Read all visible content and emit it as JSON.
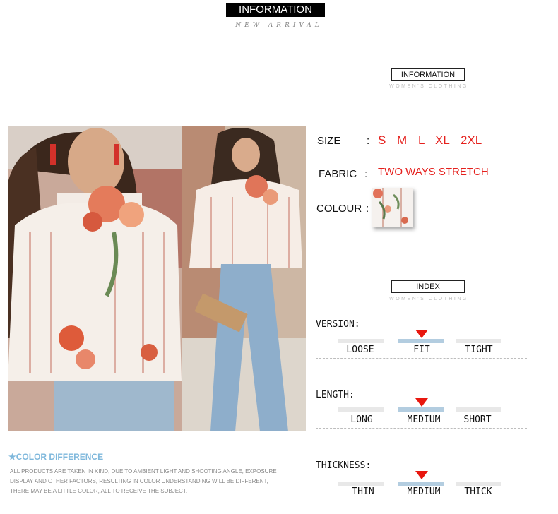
{
  "header": {
    "banner": "INFORMATION",
    "subtitle": "NEW ARRIVAL"
  },
  "info_section": {
    "title": "INFORMATION",
    "subtitle": "WOMEN'S CLOTHING"
  },
  "specs": {
    "size_label": "SIZE",
    "size_colon": ":",
    "sizes": [
      "S",
      "M",
      "L",
      "XL",
      "2XL"
    ],
    "fabric_label": "FABRIC",
    "fabric_colon": ":",
    "fabric_value": "TWO WAYS STRETCH",
    "colour_label": "COLOUR",
    "colour_colon": ":"
  },
  "index_section": {
    "title": "INDEX",
    "subtitle": "WOMEN'S CLOTHING",
    "rows": [
      {
        "label": "VERSION:",
        "options": [
          "LOOSE",
          "FIT",
          "TIGHT"
        ],
        "selected": "FIT"
      },
      {
        "label": "LENGTH:",
        "options": [
          "LONG",
          "MEDIUM",
          "SHORT"
        ],
        "selected": "MEDIUM"
      },
      {
        "label": "THICKNESS:",
        "options": [
          "THIN",
          "MEDIUM",
          "THICK"
        ],
        "selected": "MEDIUM"
      }
    ]
  },
  "color_difference": {
    "title": "★COLOR DIFFERENCE",
    "lines": [
      "ALL PRODUCTS ARE TAKEN IN KIND, DUE TO AMBIENT LIGHT AND SHOOTING ANGLE, EXPOSURE",
      "DISPLAY AND OTHER FACTORS, RESULTING IN COLOR UNDERSTANDING WILL BE DIFFERENT,",
      "THERE MAY BE A LITTLE COLOR, ALL TO RECEIVE THE SUBJECT."
    ]
  },
  "colors": {
    "accent_red": "#e5201d",
    "marker_red": "#e8170f",
    "bar_active": "#b3cde0",
    "bar_inactive": "#e8e8e8",
    "note_blue": "#7fb8dc"
  }
}
